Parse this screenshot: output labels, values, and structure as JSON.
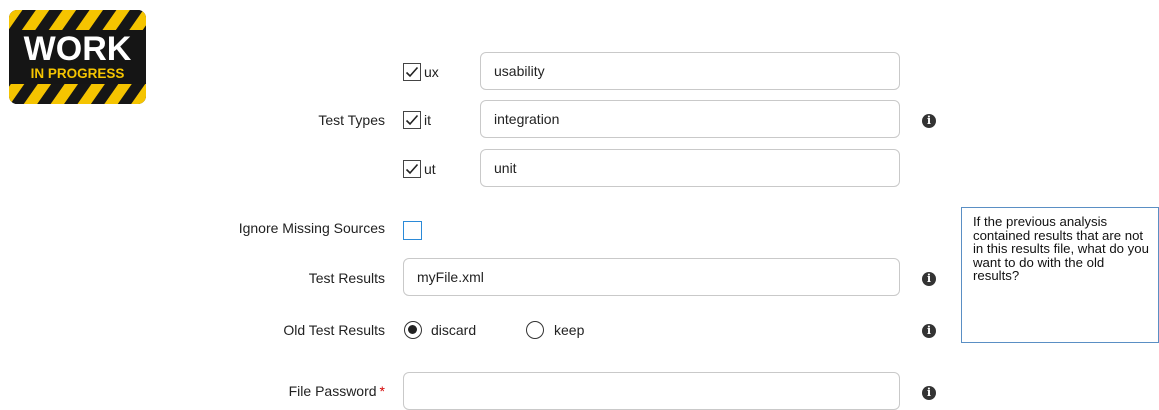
{
  "logo": {
    "line1": "WORK",
    "line2": "IN PROGRESS"
  },
  "test_types": {
    "label": "Test Types",
    "items": [
      {
        "code": "ux",
        "checked": true,
        "value": "usability"
      },
      {
        "code": "it",
        "checked": true,
        "value": "integration"
      },
      {
        "code": "ut",
        "checked": true,
        "value": "unit"
      }
    ]
  },
  "ignore_missing_sources": {
    "label": "Ignore Missing Sources",
    "checked": false
  },
  "test_results": {
    "label": "Test Results",
    "value": "myFile.xml"
  },
  "old_test_results": {
    "label": "Old Test Results",
    "options": [
      {
        "label": "discard",
        "selected": true
      },
      {
        "label": "keep",
        "selected": false
      }
    ]
  },
  "file_password": {
    "label": "File Password",
    "required_marker": "*",
    "value": ""
  },
  "tooltip": {
    "text": "If the previous analysis contained results that are not in this results file, what do you want to do with the old results?"
  },
  "icons": {
    "info": "info-icon",
    "checkmark": "check-icon"
  },
  "colors": {
    "checkbox_accent": "#2b8ad8",
    "required": "#d40000",
    "tooltip_border": "#5a8fc4"
  }
}
